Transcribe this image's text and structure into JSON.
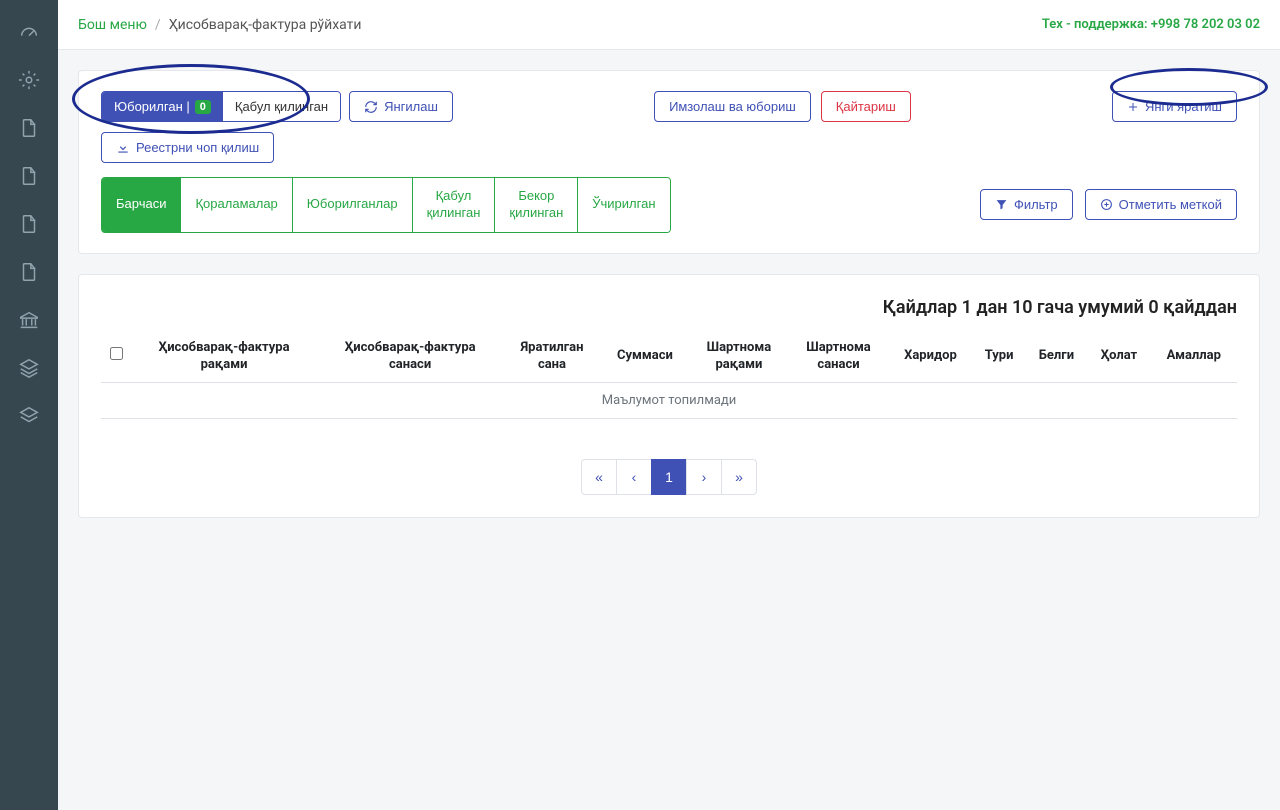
{
  "breadcrumb": {
    "home": "Бош меню",
    "current": "Ҳисобварақ-фактура рўйхати"
  },
  "support": {
    "label": "Тех - поддержка:",
    "phone": "+998 78 202 03 02"
  },
  "toolbar": {
    "seg_sent": "Юборилган |",
    "seg_badge": "0",
    "seg_received": "Қабул қилинган",
    "refresh": "Янгилаш",
    "print": "Реестрни чоп қилиш",
    "sign": "Имзолаш ва юбориш",
    "return": "Қайтариш",
    "create": "Янги яратиш"
  },
  "tabs": {
    "all": "Барчаси",
    "drafts": "Қораламалар",
    "sent": "Юборилганлар",
    "accepted_l1": "Қабул",
    "accepted_l2": "қилинган",
    "cancelled_l1": "Бекор",
    "cancelled_l2": "қилинган",
    "deleted": "Ўчирилган",
    "filter": "Фильтр",
    "mark": "Отметить меткой"
  },
  "records": {
    "info": "Қайдлар 1 дан 10 гача умумий 0 қайддан",
    "empty": "Маълумот топилмади"
  },
  "headers": {
    "invoice_num_l1": "Ҳисобварақ-фактура",
    "invoice_num_l2": "рақами",
    "invoice_date_l1": "Ҳисобварақ-фактура",
    "invoice_date_l2": "санаси",
    "created_l1": "Яратилган",
    "created_l2": "сана",
    "sum": "Суммаси",
    "contract_num_l1": "Шартнома",
    "contract_num_l2": "рақами",
    "contract_date_l1": "Шартнома",
    "contract_date_l2": "санаси",
    "buyer": "Харидор",
    "type": "Тури",
    "tag": "Белги",
    "status": "Ҳолат",
    "actions": "Амаллар"
  },
  "pagination": {
    "first": "«",
    "prev": "‹",
    "p1": "1",
    "next": "›",
    "last": "»"
  }
}
